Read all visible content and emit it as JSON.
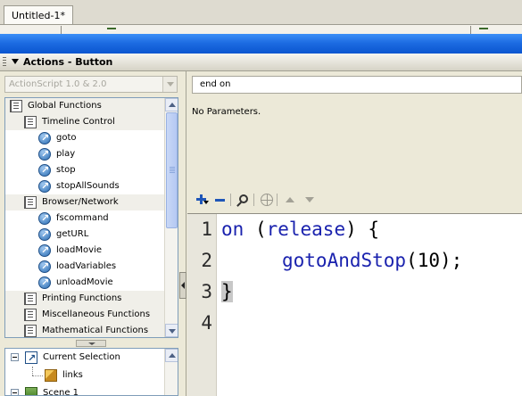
{
  "document": {
    "tab_label": "Untitled-1*"
  },
  "panel": {
    "title": "Actions - Button"
  },
  "toolbox": {
    "version_select": "ActionScript 1.0 & 2.0",
    "items": [
      {
        "label": "Global Functions",
        "kind": "book",
        "icon": "book-icon",
        "indent": 0
      },
      {
        "label": "Timeline Control",
        "kind": "book",
        "icon": "book-icon",
        "indent": 1
      },
      {
        "label": "goto",
        "kind": "fn",
        "icon": "action-icon",
        "indent": 2
      },
      {
        "label": "play",
        "kind": "fn",
        "icon": "action-icon",
        "indent": 2
      },
      {
        "label": "stop",
        "kind": "fn",
        "icon": "action-icon",
        "indent": 2
      },
      {
        "label": "stopAllSounds",
        "kind": "fn",
        "icon": "action-icon",
        "indent": 2
      },
      {
        "label": "Browser/Network",
        "kind": "book",
        "icon": "book-icon",
        "indent": 1
      },
      {
        "label": "fscommand",
        "kind": "fn",
        "icon": "action-icon",
        "indent": 2
      },
      {
        "label": "getURL",
        "kind": "fn",
        "icon": "action-icon",
        "indent": 2
      },
      {
        "label": "loadMovie",
        "kind": "fn",
        "icon": "action-icon",
        "indent": 2
      },
      {
        "label": "loadVariables",
        "kind": "fn",
        "icon": "action-icon",
        "indent": 2
      },
      {
        "label": "unloadMovie",
        "kind": "fn",
        "icon": "action-icon",
        "indent": 2
      },
      {
        "label": "Printing Functions",
        "kind": "book",
        "icon": "book-icon",
        "indent": 1
      },
      {
        "label": "Miscellaneous Functions",
        "kind": "book",
        "icon": "book-icon",
        "indent": 1
      },
      {
        "label": "Mathematical Functions",
        "kind": "book",
        "icon": "book-icon",
        "indent": 1
      }
    ]
  },
  "script_navigator": {
    "current_selection": "Current Selection",
    "child": "links",
    "scene": "Scene 1"
  },
  "action_bar": {
    "value": "end on"
  },
  "parameters": {
    "text": "No Parameters."
  },
  "toolbar_icons": [
    "add-statement-icon",
    "delete-statement-icon",
    "find-icon",
    "insert-target-path-icon",
    "move-up-icon",
    "move-down-icon"
  ],
  "script": {
    "line_numbers": [
      "1",
      "2",
      "3",
      "4"
    ],
    "line1_kw": "on",
    "line1_open": " (",
    "line1_event": "release",
    "line1_close": ") {",
    "line2_fn": "gotoAndStop",
    "line2_args": "(10);",
    "line3": "}"
  },
  "colors": {
    "titlebar_blue": "#1d6ce2",
    "keyword_blue": "#1a22ae"
  }
}
